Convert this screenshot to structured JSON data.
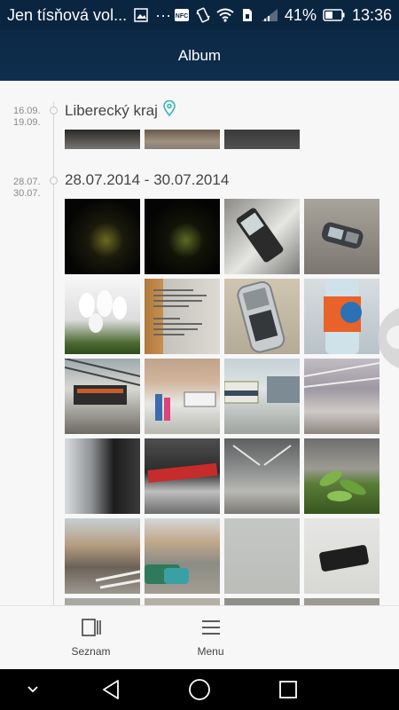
{
  "status_bar": {
    "notification_text": "Jen tísňová vol...",
    "more": "···",
    "nfc": "NFC",
    "battery_percent": "41%",
    "time": "13:36"
  },
  "app_bar": {
    "title": "Album"
  },
  "sections": [
    {
      "date_top": "16.09.",
      "date_bottom": "19.09.",
      "title": "Liberecký kraj",
      "icon": "location-pin-icon"
    },
    {
      "date_top": "28.07.",
      "date_bottom": "30.07.",
      "title": "28.07.2014 - 30.07.2014"
    }
  ],
  "toolbar": {
    "items": [
      {
        "label": "Seznam",
        "icon": "list-view-icon"
      },
      {
        "label": "Menu",
        "icon": "menu-icon"
      }
    ]
  },
  "nav_bar": {
    "icons": [
      "collapse-chevron-icon",
      "back-icon",
      "home-icon",
      "recents-icon"
    ]
  },
  "colors": {
    "status_bar": "#0a2540",
    "app_bar": "#0e2e4d",
    "location_pin": "#3bb3c3"
  }
}
